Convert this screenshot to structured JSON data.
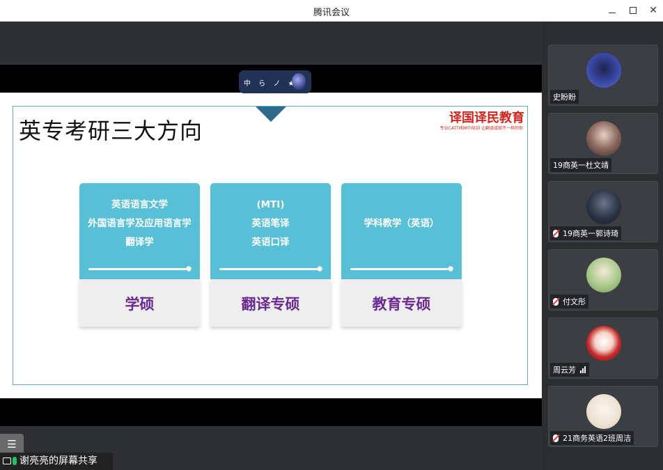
{
  "window": {
    "title": "腾讯会议"
  },
  "slide": {
    "heading": "英专考研三大方向",
    "logo_main": "译国译民教育",
    "logo_sub": "专业CATTI和MTI培训 让翻译成就不一样的你",
    "cards": [
      {
        "lines": [
          "英语语言文学",
          "外国语言学及应用语言学",
          "翻译学"
        ],
        "label": "学硕"
      },
      {
        "lines": [
          "(MTI)",
          "英语笔译",
          "英语口译"
        ],
        "label": "翻译专硕"
      },
      {
        "lines": [
          "学科教学（英语）"
        ],
        "label": "教育专硕"
      }
    ]
  },
  "widget": {
    "text": "中 ら ノ ★"
  },
  "status": {
    "share_text": "谢亮亮的屏幕共享"
  },
  "participants": [
    {
      "name": "史盼盼",
      "muted": false
    },
    {
      "name": "19商英一杜文靖",
      "muted": false
    },
    {
      "name": "19商英一郭诗琦",
      "muted": true
    },
    {
      "name": "付文彤",
      "muted": true
    },
    {
      "name": "周云芳",
      "muted": false,
      "signal": true
    },
    {
      "name": "21商务英语2班周洁",
      "muted": true
    }
  ],
  "colors": {
    "card_top": "#57bfd6",
    "card_label": "#6a2a93",
    "logo": "#d7231c",
    "frame": "#5aa9c9"
  }
}
